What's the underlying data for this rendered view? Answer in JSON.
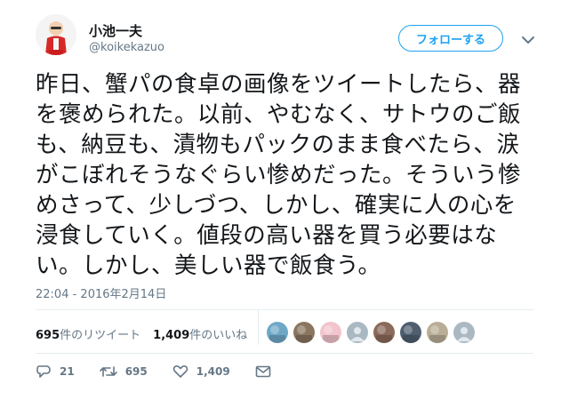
{
  "user": {
    "display_name": "小池一夫",
    "screen_name": "@koikekazuo"
  },
  "follow_button_label": "フォローする",
  "tweet": {
    "text": "昨日、蟹パの食卓の画像をツイートしたら、器を褒められた。以前、やむなく、サトウのご飯も、納豆も、漬物もパックのまま食べたら、涙がこぼれそうなぐらい惨めだった。そういう惨めさって、少しづつ、しかし、確実に人の心を浸食していく。値段の高い器を買う必要はない。しかし、美しい器で飯食う。",
    "timestamp": "22:04 - 2016年2月14日"
  },
  "stats": {
    "retweets_count": "695",
    "retweets_label": "件のリツイート",
    "likes_count": "1,409",
    "likes_label": "件のいいね"
  },
  "likers": [
    {
      "icon": "avatar-ocean",
      "color": "#6fa8c7"
    },
    {
      "icon": "avatar-photo",
      "color": "#8a7560"
    },
    {
      "icon": "avatar-pink-face",
      "color": "#f2c4cc"
    },
    {
      "icon": "avatar-default-egg",
      "color": "#aab8c2"
    },
    {
      "icon": "avatar-group",
      "color": "#8a6a5a"
    },
    {
      "icon": "avatar-city",
      "color": "#4f5f70"
    },
    {
      "icon": "avatar-figure",
      "color": "#b9ad96"
    },
    {
      "icon": "avatar-default-egg",
      "color": "#aab8c2"
    }
  ],
  "actions": {
    "reply_count": "21",
    "retweet_count": "695",
    "like_count": "1,409"
  },
  "colors": {
    "accent": "#1da1f2",
    "secondary_text": "#657786",
    "divider": "#e6ecf0"
  }
}
